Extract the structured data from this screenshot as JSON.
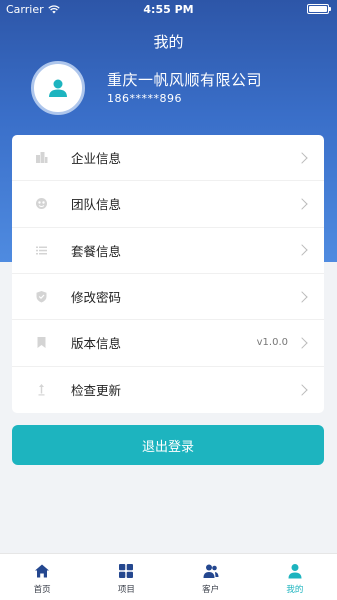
{
  "status_bar": {
    "carrier": "Carrier",
    "time": "4:55 PM"
  },
  "header": {
    "title": "我的",
    "company_name": "重庆一帆风顺有限公司",
    "phone": "186*****896"
  },
  "menu": [
    {
      "label": "企业信息",
      "icon": "building-icon"
    },
    {
      "label": "团队信息",
      "icon": "team-icon"
    },
    {
      "label": "套餐信息",
      "icon": "list-icon"
    },
    {
      "label": "修改密码",
      "icon": "shield-icon"
    },
    {
      "label": "版本信息",
      "icon": "bookmark-icon",
      "value": "v1.0.0"
    },
    {
      "label": "检查更新",
      "icon": "update-icon"
    }
  ],
  "logout_label": "退出登录",
  "tabs": [
    {
      "label": "首页",
      "icon": "home-icon",
      "active": false
    },
    {
      "label": "项目",
      "icon": "grid-icon",
      "active": false
    },
    {
      "label": "客户",
      "icon": "customers-icon",
      "active": false
    },
    {
      "label": "我的",
      "icon": "person-icon",
      "active": true
    }
  ],
  "colors": {
    "header_gradient_top": "#2d56a8",
    "header_gradient_bottom": "#4f8be0",
    "accent": "#1db4bf",
    "background": "#f1f3f6"
  }
}
